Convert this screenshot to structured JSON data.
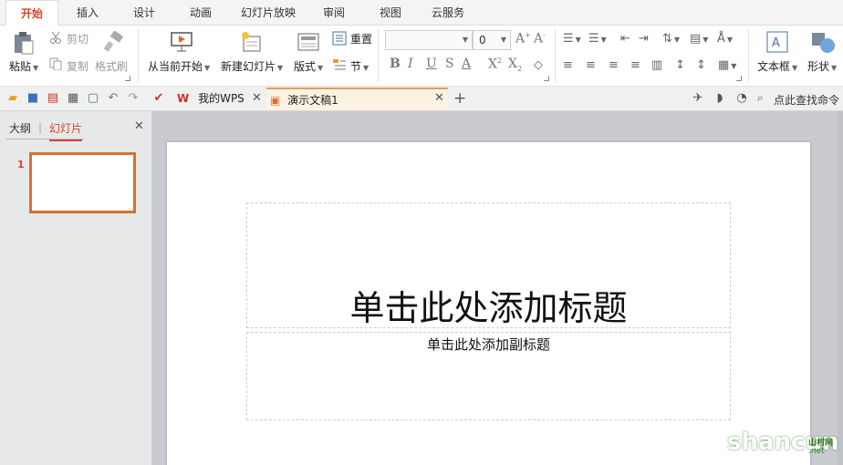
{
  "menu": {
    "tabs": [
      "开始",
      "插入",
      "设计",
      "动画",
      "幻灯片放映",
      "审阅",
      "视图",
      "云服务"
    ],
    "active": "开始"
  },
  "ribbon": {
    "paste": "粘贴",
    "cut": "剪切",
    "copy": "复制",
    "format_painter": "格式刷",
    "from_current": "从当前开始",
    "new_slide": "新建幻灯片",
    "layout": "版式",
    "reset": "重置",
    "section": "节",
    "font_size": "0",
    "textbox": "文本框",
    "shape": "形状"
  },
  "quickbar": {
    "tab_wps": "我的WPS",
    "tab_doc": "演示文稿1",
    "search": "点此查找命令"
  },
  "left_panel": {
    "outline_tab": "大纲",
    "slides_tab": "幻灯片",
    "slide_number": "1"
  },
  "slide": {
    "title_placeholder": "单击此处添加标题",
    "subtitle_placeholder": "单击此处添加副标题"
  },
  "watermark": {
    "text": "shancun",
    "small": "山村网",
    "domain": ".net"
  },
  "colors": {
    "accent": "#d24726",
    "thumb_border": "#d8702e",
    "canvas_bg": "#c9cbd1"
  }
}
